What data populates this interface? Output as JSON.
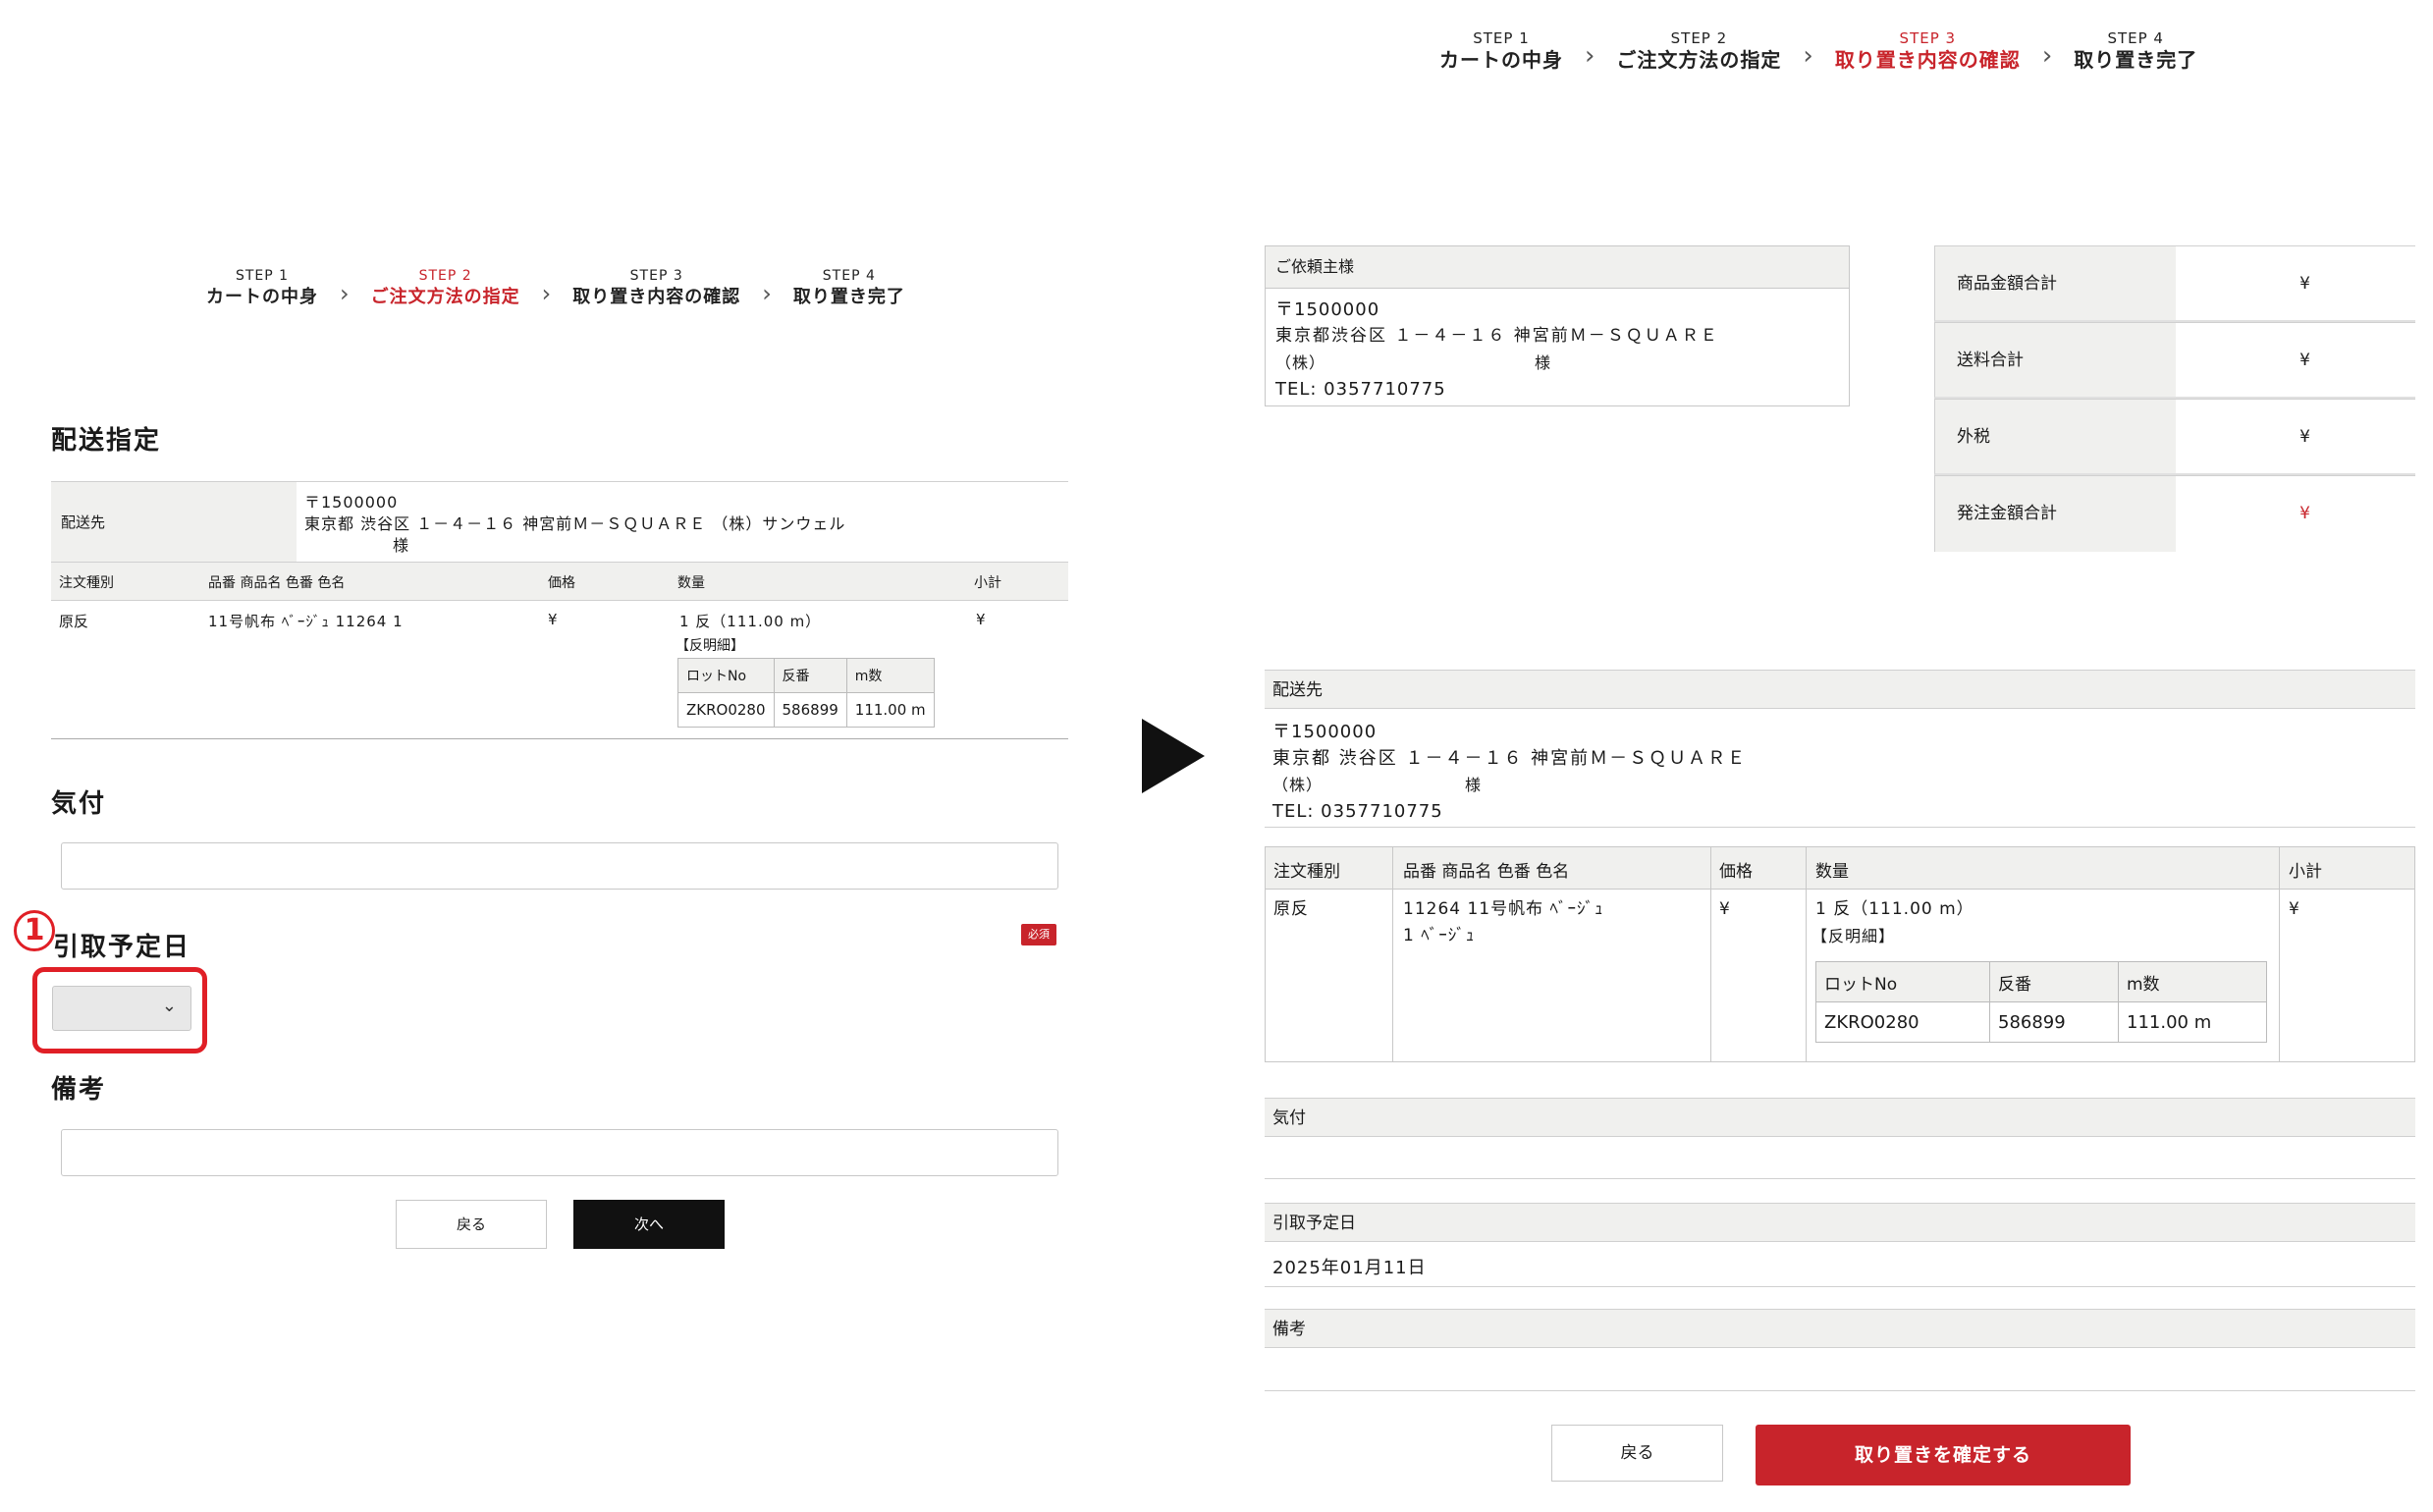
{
  "left": {
    "steps": [
      {
        "num": "STEP 1",
        "label": "カートの中身"
      },
      {
        "num": "STEP 2",
        "label": "ご注文方法の指定"
      },
      {
        "num": "STEP 3",
        "label": "取り置き内容の確認"
      },
      {
        "num": "STEP 4",
        "label": "取り置き完了"
      }
    ],
    "delivery_title": "配送指定",
    "destination_label": "配送先",
    "destination_lines": [
      "〒1500000",
      "東京都 渋谷区 １－４－１６ 神宮前Ｍ－ＳＱＵＡＲＥ （株）サンウェル",
      "様"
    ],
    "table_headers": {
      "type": "注文種別",
      "product": "品番 商品名 色番 色名",
      "price": "価格",
      "qty": "数量",
      "subtotal": "小計"
    },
    "item": {
      "type": "原反",
      "product": "11号帆布 ﾍﾞｰｼﾞｭ 11264 1",
      "price": "¥",
      "qty": "1 反（111.00 m）",
      "detail": "【反明細】",
      "subtotal": "¥"
    },
    "lot_headers": [
      "ロットNo",
      "反番",
      "m数"
    ],
    "lot_row": [
      "ZKRO0280",
      "586899",
      "111.00 m"
    ],
    "attention_title": "気付",
    "pickup_title": "引取予定日",
    "required_badge": "必須",
    "remarks_title": "備考",
    "back_button": "戻る",
    "next_button": "次へ",
    "callout_number": "1"
  },
  "right": {
    "steps": [
      {
        "num": "STEP 1",
        "label": "カートの中身"
      },
      {
        "num": "STEP 2",
        "label": "ご注文方法の指定"
      },
      {
        "num": "STEP 3",
        "label": "取り置き内容の確認"
      },
      {
        "num": "STEP 4",
        "label": "取り置き完了"
      }
    ],
    "client_head": "ご依頼主様",
    "client_lines": [
      "〒1500000",
      "東京都渋谷区 １－４－１６ 神宮前Ｍ－ＳＱＵＡＲＥ",
      "（株）　　　　　　　　　　　　　様",
      "TEL: 0357710775"
    ],
    "totals": [
      {
        "label": "商品金額合計",
        "value": "¥"
      },
      {
        "label": "送料合計",
        "value": "¥"
      },
      {
        "label": "外税",
        "value": "¥"
      },
      {
        "label": "発注金額合計",
        "value": "¥"
      }
    ],
    "destination_head": "配送先",
    "destination_lines": [
      "〒1500000",
      "東京都 渋谷区 １－４－１６ 神宮前Ｍ－ＳＱＵＡＲＥ",
      "（株）　　　　　　　　　様",
      "TEL: 0357710775"
    ],
    "table_headers": {
      "type": "注文種別",
      "product": "品番 商品名 色番 色名",
      "price": "価格",
      "qty": "数量",
      "subtotal": "小計"
    },
    "item": {
      "type": "原反",
      "product_line1": "11264 11号帆布 ﾍﾞｰｼﾞｭ",
      "product_line2": "1 ﾍﾞｰｼﾞｭ",
      "price": "¥",
      "qty": "1 反（111.00 m）",
      "detail": "【反明細】",
      "subtotal": "¥"
    },
    "lot_headers": [
      "ロットNo",
      "反番",
      "m数"
    ],
    "lot_row": [
      "ZKRO0280",
      "586899",
      "111.00 m"
    ],
    "attention_head": "気付",
    "pickup_head": "引取予定日",
    "pickup_value": "2025年01月11日",
    "remarks_head": "備考",
    "back_button": "戻る",
    "confirm_button": "取り置きを確定する"
  }
}
